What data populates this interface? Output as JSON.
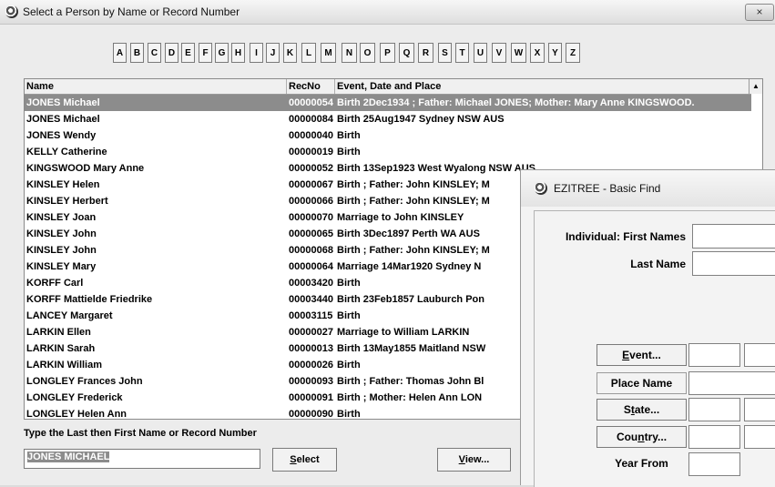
{
  "main_window": {
    "title": "Select a Person by Name or Record Number",
    "close_label": "×",
    "alphabet": [
      "A",
      "B",
      "C",
      "D",
      "E",
      "F",
      "G",
      "H",
      "I",
      "J",
      "K",
      "L",
      "M",
      "N",
      "O",
      "P",
      "Q",
      "R",
      "S",
      "T",
      "U",
      "V",
      "W",
      "X",
      "Y",
      "Z"
    ],
    "table": {
      "columns": [
        "Name",
        "RecNo",
        "Event, Date and Place"
      ],
      "scroll_up_icon": "▲",
      "rows": [
        {
          "name": "JONES Michael",
          "recno": "00000054",
          "event": "Birth 2Dec1934 ; Father: Michael JONES; Mother: Mary Anne KINGSWOOD.",
          "selected": true
        },
        {
          "name": "JONES Michael",
          "recno": "00000084",
          "event": "Birth 25Aug1947 Sydney NSW AUS"
        },
        {
          "name": "JONES Wendy",
          "recno": "00000040",
          "event": "Birth"
        },
        {
          "name": "KELLY Catherine",
          "recno": "00000019",
          "event": "Birth"
        },
        {
          "name": "KINGSWOOD Mary Anne",
          "recno": "00000052",
          "event": "Birth 13Sep1923 West Wyalong NSW AUS"
        },
        {
          "name": "KINSLEY Helen",
          "recno": "00000067",
          "event": "Birth ; Father: John KINSLEY; M"
        },
        {
          "name": "KINSLEY Herbert",
          "recno": "00000066",
          "event": "Birth ; Father: John KINSLEY; M"
        },
        {
          "name": "KINSLEY Joan",
          "recno": "00000070",
          "event": "Marriage  to John KINSLEY"
        },
        {
          "name": "KINSLEY John",
          "recno": "00000065",
          "event": "Birth 3Dec1897 Perth WA AUS"
        },
        {
          "name": "KINSLEY John",
          "recno": "00000068",
          "event": "Birth ; Father: John KINSLEY; M"
        },
        {
          "name": "KINSLEY Mary",
          "recno": "00000064",
          "event": "Marriage 14Mar1920 Sydney N"
        },
        {
          "name": "KORFF Carl",
          "recno": "00003420",
          "event": "Birth"
        },
        {
          "name": "KORFF Mattielde Friedrike",
          "recno": "00003440",
          "event": "Birth 23Feb1857 Lauburch Pon"
        },
        {
          "name": "LANCEY Margaret",
          "recno": "00003115",
          "event": "Birth"
        },
        {
          "name": "LARKIN Ellen",
          "recno": "00000027",
          "event": "Marriage  to William LARKIN"
        },
        {
          "name": "LARKIN Sarah",
          "recno": "00000013",
          "event": "Birth 13May1855 Maitland NSW"
        },
        {
          "name": "LARKIN William",
          "recno": "00000026",
          "event": "Birth"
        },
        {
          "name": "LONGLEY Frances John",
          "recno": "00000093",
          "event": "Birth ; Father: Thomas John Bl"
        },
        {
          "name": "LONGLEY Frederick",
          "recno": "00000091",
          "event": "Birth ; Mother: Helen Ann LON"
        },
        {
          "name": "LONGLEY Helen Ann",
          "recno": "00000090",
          "event": "Birth"
        }
      ]
    },
    "prompt": "Type the Last then First Name or Record Number",
    "name_value": "JONES MICHAEL",
    "select_label_u": "S",
    "select_label_rest": "elect",
    "view_label_u": "V",
    "view_label_rest": "iew..."
  },
  "find_dialog": {
    "title": "EZITREE - Basic Find",
    "first_names_label": "Individual: First Names",
    "last_name_label": "Last Name",
    "event_u": "E",
    "event_rest": "vent...",
    "place_name_label": "Place Name",
    "state_pre": "S",
    "state_u": "t",
    "state_rest": "ate...",
    "country_pre": "Cou",
    "country_u": "n",
    "country_rest": "try...",
    "year_from_label": "Year From"
  },
  "colors": {
    "selection": "#8c8c8c",
    "window_bg": "#ececec"
  }
}
